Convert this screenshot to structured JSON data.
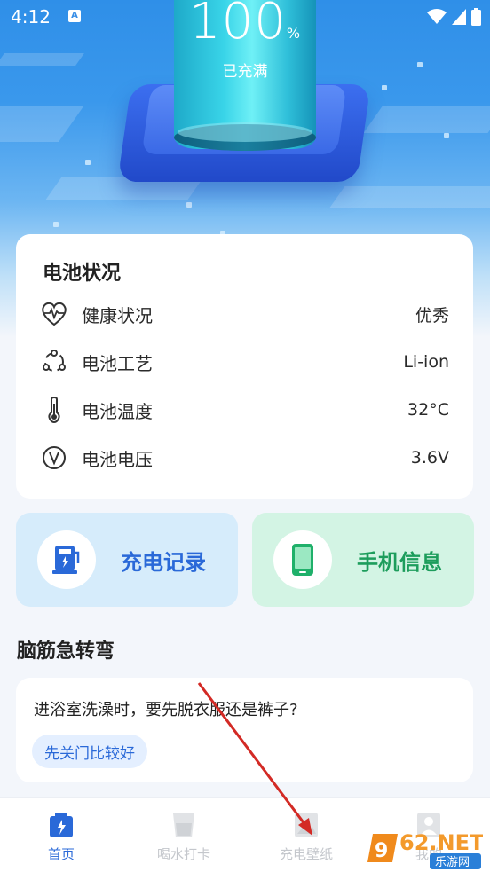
{
  "status_bar": {
    "time": "4:12",
    "notification_badge": "A"
  },
  "battery": {
    "percent": "100",
    "unit": "%",
    "status": "已充满"
  },
  "battery_status": {
    "title": "电池状况",
    "rows": [
      {
        "icon": "heart-pulse-icon",
        "label": "健康状况",
        "value": "优秀"
      },
      {
        "icon": "cycle-icon",
        "label": "电池工艺",
        "value": "Li-ion"
      },
      {
        "icon": "thermometer-icon",
        "label": "电池温度",
        "value": "32°C"
      },
      {
        "icon": "voltage-icon",
        "label": "电池电压",
        "value": "3.6V"
      }
    ]
  },
  "actions": {
    "charge_record": "充电记录",
    "phone_info": "手机信息"
  },
  "riddle": {
    "section_title": "脑筋急转弯",
    "question": "进浴室洗澡时，要先脱衣服还是裤子?",
    "answer": "先关门比较好"
  },
  "tabs": [
    {
      "label": "首页",
      "icon": "home-battery-icon",
      "active": true
    },
    {
      "label": "喝水打卡",
      "icon": "water-cup-icon",
      "active": false
    },
    {
      "label": "充电壁纸",
      "icon": "wallpaper-icon",
      "active": false
    },
    {
      "label": "我的",
      "icon": "profile-icon",
      "active": false
    }
  ],
  "watermark": {
    "text": "962.NET",
    "sub": "乐游网"
  },
  "colors": {
    "accent": "#2a69d8",
    "green": "#1d9d5c",
    "hero_blue": "#2f8fe8"
  }
}
